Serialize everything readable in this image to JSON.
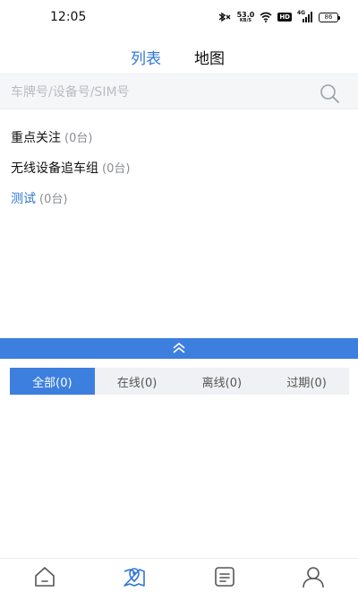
{
  "status_bar": {
    "time": "12:05",
    "net_speed_value": "53.0",
    "net_speed_unit": "KB/S",
    "hd_badge": "HD",
    "signal_label": "4G",
    "battery_level": "86"
  },
  "top_tabs": [
    {
      "label": "列表",
      "active": true
    },
    {
      "label": "地图",
      "active": false
    }
  ],
  "search": {
    "placeholder": "车牌号/设备号/SIM号",
    "value": ""
  },
  "groups": [
    {
      "name": "重点关注",
      "count": "(0台)"
    },
    {
      "name": "无线设备追车组",
      "count": "(0台)"
    },
    {
      "name": "测试",
      "count": "(0台)"
    }
  ],
  "status_tabs": [
    {
      "label": "全部(0)",
      "active": true
    },
    {
      "label": "在线(0)",
      "active": false
    },
    {
      "label": "离线(0)",
      "active": false
    },
    {
      "label": "过期(0)",
      "active": false
    }
  ],
  "bottom_nav": [
    {
      "icon": "home-icon",
      "active": false
    },
    {
      "icon": "map-pin-icon",
      "active": true
    },
    {
      "icon": "list-doc-icon",
      "active": false
    },
    {
      "icon": "user-icon",
      "active": false
    }
  ],
  "colors": {
    "accent": "#3d7fdf",
    "accent_text": "#2f77d6",
    "muted": "#8a8d93"
  }
}
